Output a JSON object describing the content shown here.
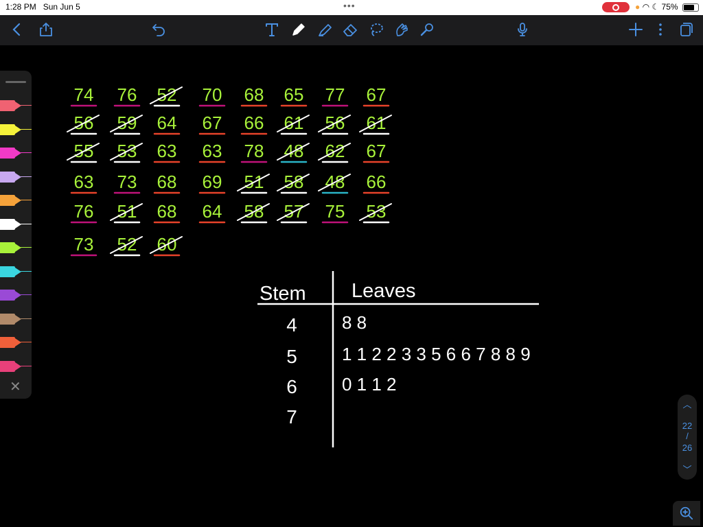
{
  "status": {
    "time": "1:28 PM",
    "date": "Sun Jun 5",
    "battery": "75%",
    "battery_level": 0.75
  },
  "toolbar": {
    "accent": "#4a90e2",
    "left": [
      "back-icon",
      "share-icon",
      "undo-icon"
    ],
    "tools": [
      "text-tool-icon",
      "pen-tool-icon",
      "highlighter-tool-icon",
      "eraser-tool-icon",
      "lasso-tool-icon",
      "image-tool-icon",
      "laser-pointer-icon"
    ],
    "right": [
      "microphone-icon",
      "add-page-icon",
      "more-icon",
      "pages-icon"
    ]
  },
  "data_grid": {
    "rows": [
      [
        "74",
        "76",
        "52",
        "70",
        "68",
        "65",
        "77",
        "67"
      ],
      [
        "56",
        "59",
        "64",
        "67",
        "66",
        "61",
        "56",
        "61"
      ],
      [
        "55",
        "53",
        "63",
        "63",
        "78",
        "48",
        "62",
        "67"
      ],
      [
        "63",
        "73",
        "68",
        "69",
        "51",
        "58",
        "48",
        "66"
      ],
      [
        "76",
        "51",
        "68",
        "64",
        "58",
        "57",
        "75",
        "53"
      ],
      [
        "73",
        "52",
        "60"
      ]
    ],
    "crossed": [
      [
        false,
        false,
        true,
        false,
        false,
        false,
        false,
        false
      ],
      [
        true,
        true,
        false,
        false,
        false,
        true,
        true,
        true
      ],
      [
        true,
        true,
        false,
        false,
        false,
        true,
        true,
        false
      ],
      [
        false,
        false,
        false,
        false,
        true,
        true,
        true,
        false
      ],
      [
        false,
        true,
        false,
        false,
        true,
        true,
        false,
        true
      ],
      [
        false,
        true,
        true
      ]
    ],
    "underline_colors": [
      [
        "#c0127a",
        "#c0127a",
        "#ffffff",
        "#c0127a",
        "#e8432a",
        "#e8432a",
        "#c0127a",
        "#e8432a"
      ],
      [
        "#ffffff",
        "#ffffff",
        "#e8432a",
        "#e8432a",
        "#e8432a",
        "#ffffff",
        "#ffffff",
        "#ffffff"
      ],
      [
        "#ffffff",
        "#ffffff",
        "#e8432a",
        "#e8432a",
        "#c0127a",
        "#2ab5c8",
        "#ffffff",
        "#e8432a"
      ],
      [
        "#e8432a",
        "#c0127a",
        "#e8432a",
        "#e8432a",
        "#ffffff",
        "#ffffff",
        "#2ab5c8",
        "#e8432a"
      ],
      [
        "#c0127a",
        "#ffffff",
        "#e8432a",
        "#e8432a",
        "#ffffff",
        "#ffffff",
        "#c0127a",
        "#ffffff"
      ],
      [
        "#c0127a",
        "#ffffff",
        "#e8432a"
      ]
    ],
    "ink_color": "#a8f23a"
  },
  "stem_leaf": {
    "stem_header": "Stem",
    "leaves_header": "Leaves",
    "rows": [
      {
        "stem": "4",
        "leaves": "8 8"
      },
      {
        "stem": "5",
        "leaves": "1 1 2 2 3 3 5 6 6 7 8 8 9"
      },
      {
        "stem": "6",
        "leaves": "0 1 1 2"
      },
      {
        "stem": "7",
        "leaves": ""
      }
    ]
  },
  "pens": [
    "#f06272",
    "#f5f23a",
    "#f23ac6",
    "#c8a8f0",
    "#f5a23a",
    "#ffffff",
    "#a8f23a",
    "#3ad6e0",
    "#9a4ad6",
    "#b08a6a",
    "#f0603a",
    "#e8407a"
  ],
  "page_nav": {
    "current": "22",
    "separator": "/",
    "total": "26"
  }
}
